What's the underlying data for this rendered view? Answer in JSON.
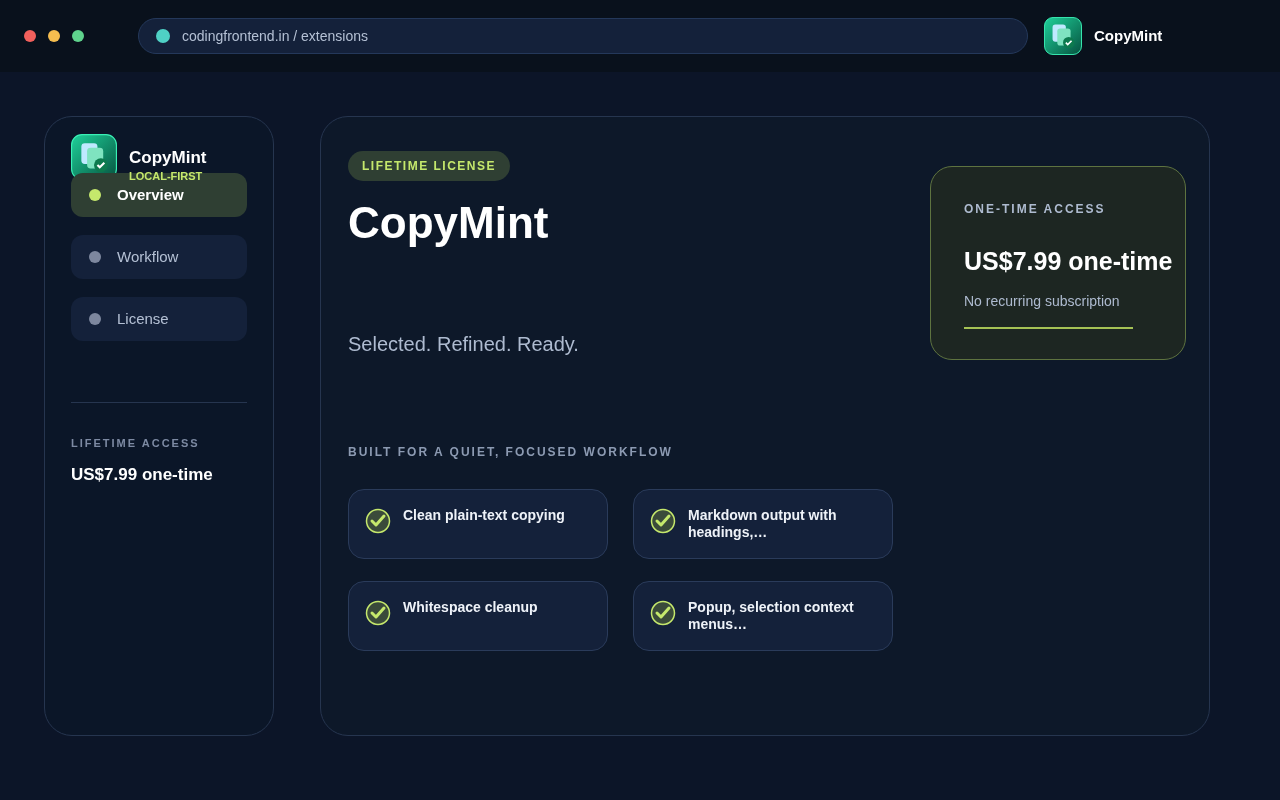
{
  "browser": {
    "url": "codingfrontend.in / extensions",
    "app_name": "CopyMint"
  },
  "sidebar": {
    "brand": "CopyMint",
    "tagline": "LOCAL-FIRST",
    "items": [
      {
        "label": "Overview",
        "selected": true
      },
      {
        "label": "Workflow",
        "selected": false
      },
      {
        "label": "License",
        "selected": false
      }
    ],
    "access_label": "LIFETIME ACCESS",
    "access_price": "US$7.99 one-time"
  },
  "hero": {
    "badge": "LIFETIME LICENSE",
    "title": "CopyMint",
    "subtitle": "Selected. Refined. Ready."
  },
  "price_card": {
    "label": "ONE-TIME ACCESS",
    "price": "US$7.99 one-time",
    "note": "No recurring subscription"
  },
  "features": {
    "heading": "BUILT FOR A QUIET, FOCUSED WORKFLOW",
    "items": [
      "Clean plain-text copying",
      "Markdown output with headings,…",
      "Whitespace cleanup",
      "Popup, selection context menus…"
    ]
  }
}
